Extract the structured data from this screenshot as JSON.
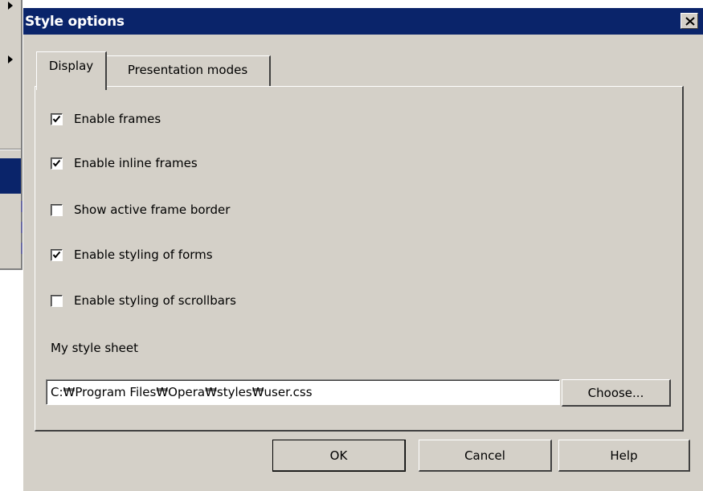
{
  "dialog": {
    "title": "Style options",
    "close_icon": "close-icon"
  },
  "tabs": [
    {
      "label": "Display",
      "active": true
    },
    {
      "label": "Presentation modes",
      "active": false
    }
  ],
  "options": [
    {
      "label": "Enable frames",
      "checked": true
    },
    {
      "label": "Enable inline frames",
      "checked": true
    },
    {
      "label": "Show active frame border",
      "checked": false
    },
    {
      "label": "Enable styling of forms",
      "checked": true
    },
    {
      "label": "Enable styling of scrollbars",
      "checked": false
    }
  ],
  "stylesheet": {
    "label": "My style sheet",
    "path": "C:₩Program Files₩Opera₩styles₩user.css",
    "choose_label": "Choose..."
  },
  "buttons": {
    "ok": "OK",
    "cancel": "Cancel",
    "help": "Help"
  },
  "colors": {
    "titlebar": "#0a246a",
    "face": "#d4d0c8"
  }
}
